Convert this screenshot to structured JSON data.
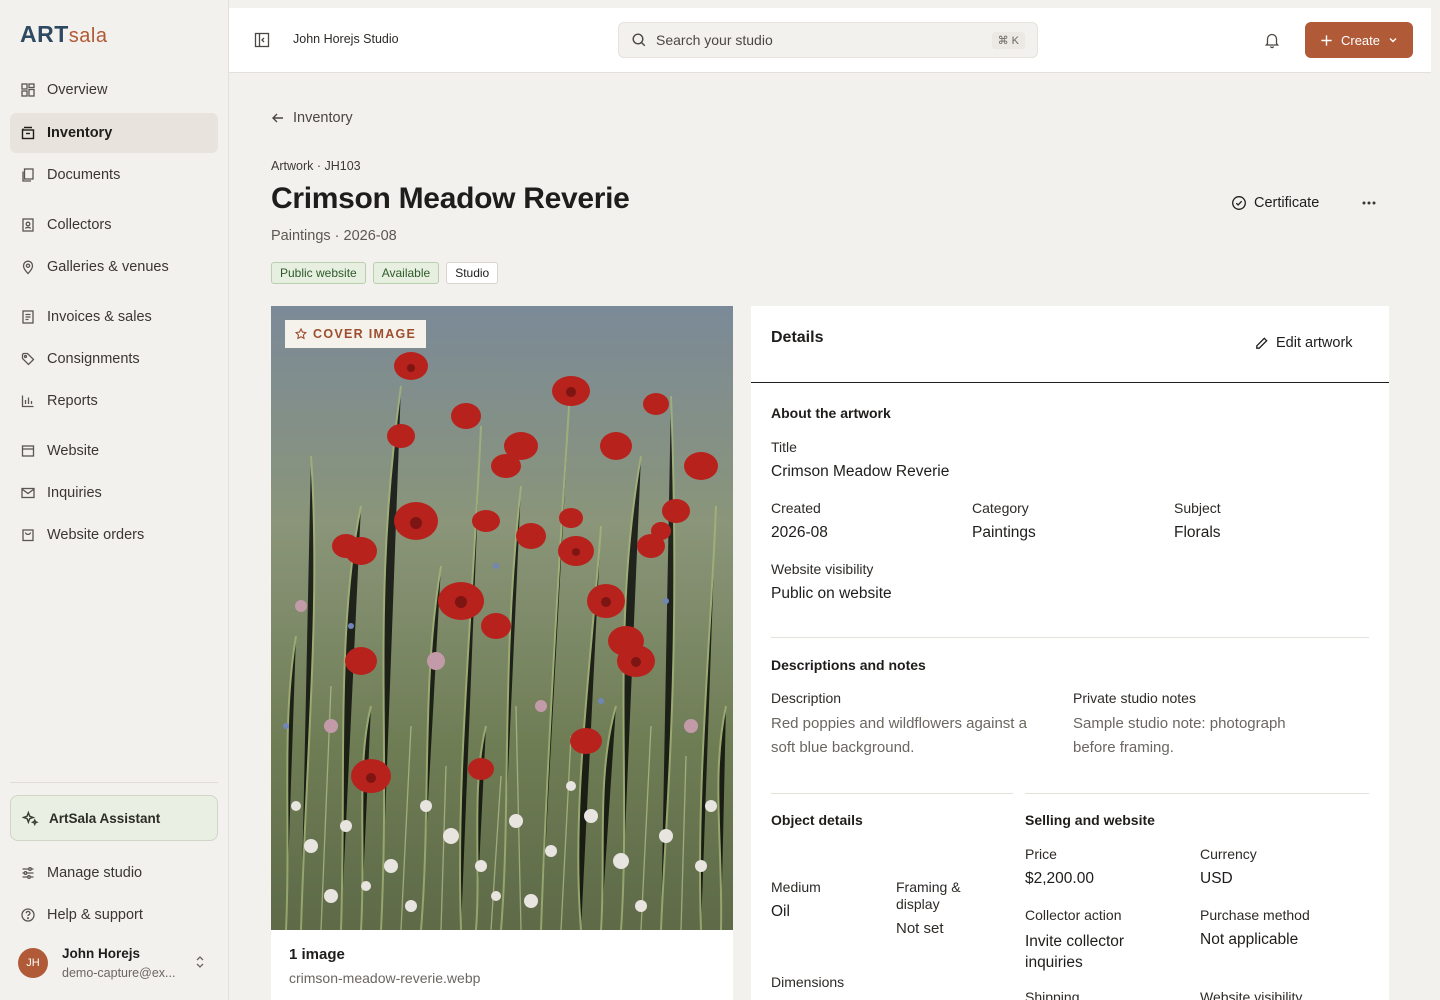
{
  "brand": {
    "part1": "ART",
    "part2": "sala"
  },
  "sidebar": {
    "items": [
      {
        "label": "Overview",
        "icon": "grid-icon"
      },
      {
        "label": "Inventory",
        "icon": "archive-icon"
      },
      {
        "label": "Documents",
        "icon": "documents-icon"
      },
      {
        "label": "Collectors",
        "icon": "contact-icon"
      },
      {
        "label": "Galleries & venues",
        "icon": "map-pin-icon"
      },
      {
        "label": "Invoices & sales",
        "icon": "invoice-icon"
      },
      {
        "label": "Consignments",
        "icon": "tag-icon"
      },
      {
        "label": "Reports",
        "icon": "bar-chart-icon"
      },
      {
        "label": "Website",
        "icon": "browser-icon"
      },
      {
        "label": "Inquiries",
        "icon": "mail-icon"
      },
      {
        "label": "Website orders",
        "icon": "cart-icon"
      }
    ],
    "assistant": "ArtSala Assistant",
    "manage": "Manage studio",
    "help": "Help & support",
    "user": {
      "initials": "JH",
      "name": "John Horejs",
      "email": "demo-capture@ex..."
    }
  },
  "topbar": {
    "studio": "John Horejs Studio",
    "search_placeholder": "Search your studio",
    "shortcut": "⌘ K",
    "create_label": "Create"
  },
  "page": {
    "back_label": "Inventory",
    "eyebrow": "Artwork · JH103",
    "title": "Crimson Meadow Reverie",
    "subtitle": "Paintings · 2026-08",
    "tags": [
      "Public website",
      "Available",
      "Studio"
    ],
    "certificate": "Certificate"
  },
  "image": {
    "badge": "COVER IMAGE",
    "count": "1 image",
    "filename": "crimson-meadow-reverie.webp"
  },
  "details": {
    "heading": "Details",
    "edit_label": "Edit artwork",
    "about": {
      "heading": "About the artwork",
      "title_label": "Title",
      "title_value": "Crimson Meadow Reverie",
      "created_label": "Created",
      "created_value": "2026-08",
      "category_label": "Category",
      "category_value": "Paintings",
      "subject_label": "Subject",
      "subject_value": "Florals",
      "visibility_label": "Website visibility",
      "visibility_value": "Public on website"
    },
    "notes": {
      "heading": "Descriptions and notes",
      "desc_label": "Description",
      "desc_line1": "Red poppies and wildflowers against a",
      "desc_line2": "soft blue background.",
      "private_label": "Private studio notes",
      "private_line1": "Sample studio note: photograph",
      "private_line2": "before framing."
    },
    "object": {
      "heading": "Object details",
      "medium_label": "Medium",
      "medium_value": "Oil",
      "framing_label1": "Framing &",
      "framing_label2": "display",
      "framing_value": "Not set",
      "dimensions_label": "Dimensions"
    },
    "selling": {
      "heading": "Selling and website",
      "price_label": "Price",
      "price_value": "$2,200.00",
      "currency_label": "Currency",
      "currency_value": "USD",
      "action_label": "Collector action",
      "action_line1": "Invite collector",
      "action_line2": "inquiries",
      "method_label": "Purchase method",
      "method_value": "Not applicable",
      "shipping_label": "Shipping",
      "visibility_label": "Website visibility"
    }
  },
  "colors": {
    "accent": "#b05a37",
    "brand_blue": "#2e4a63",
    "tag_green": "#e6efe0"
  }
}
